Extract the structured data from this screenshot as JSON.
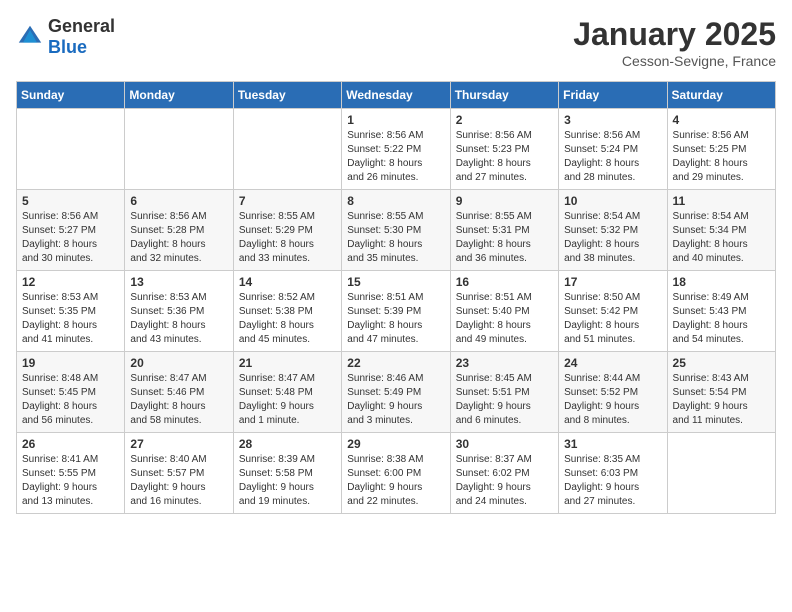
{
  "header": {
    "logo_general": "General",
    "logo_blue": "Blue",
    "month": "January 2025",
    "location": "Cesson-Sevigne, France"
  },
  "weekdays": [
    "Sunday",
    "Monday",
    "Tuesday",
    "Wednesday",
    "Thursday",
    "Friday",
    "Saturday"
  ],
  "weeks": [
    [
      {
        "day": "",
        "info": ""
      },
      {
        "day": "",
        "info": ""
      },
      {
        "day": "",
        "info": ""
      },
      {
        "day": "1",
        "info": "Sunrise: 8:56 AM\nSunset: 5:22 PM\nDaylight: 8 hours\nand 26 minutes."
      },
      {
        "day": "2",
        "info": "Sunrise: 8:56 AM\nSunset: 5:23 PM\nDaylight: 8 hours\nand 27 minutes."
      },
      {
        "day": "3",
        "info": "Sunrise: 8:56 AM\nSunset: 5:24 PM\nDaylight: 8 hours\nand 28 minutes."
      },
      {
        "day": "4",
        "info": "Sunrise: 8:56 AM\nSunset: 5:25 PM\nDaylight: 8 hours\nand 29 minutes."
      }
    ],
    [
      {
        "day": "5",
        "info": "Sunrise: 8:56 AM\nSunset: 5:27 PM\nDaylight: 8 hours\nand 30 minutes."
      },
      {
        "day": "6",
        "info": "Sunrise: 8:56 AM\nSunset: 5:28 PM\nDaylight: 8 hours\nand 32 minutes."
      },
      {
        "day": "7",
        "info": "Sunrise: 8:55 AM\nSunset: 5:29 PM\nDaylight: 8 hours\nand 33 minutes."
      },
      {
        "day": "8",
        "info": "Sunrise: 8:55 AM\nSunset: 5:30 PM\nDaylight: 8 hours\nand 35 minutes."
      },
      {
        "day": "9",
        "info": "Sunrise: 8:55 AM\nSunset: 5:31 PM\nDaylight: 8 hours\nand 36 minutes."
      },
      {
        "day": "10",
        "info": "Sunrise: 8:54 AM\nSunset: 5:32 PM\nDaylight: 8 hours\nand 38 minutes."
      },
      {
        "day": "11",
        "info": "Sunrise: 8:54 AM\nSunset: 5:34 PM\nDaylight: 8 hours\nand 40 minutes."
      }
    ],
    [
      {
        "day": "12",
        "info": "Sunrise: 8:53 AM\nSunset: 5:35 PM\nDaylight: 8 hours\nand 41 minutes."
      },
      {
        "day": "13",
        "info": "Sunrise: 8:53 AM\nSunset: 5:36 PM\nDaylight: 8 hours\nand 43 minutes."
      },
      {
        "day": "14",
        "info": "Sunrise: 8:52 AM\nSunset: 5:38 PM\nDaylight: 8 hours\nand 45 minutes."
      },
      {
        "day": "15",
        "info": "Sunrise: 8:51 AM\nSunset: 5:39 PM\nDaylight: 8 hours\nand 47 minutes."
      },
      {
        "day": "16",
        "info": "Sunrise: 8:51 AM\nSunset: 5:40 PM\nDaylight: 8 hours\nand 49 minutes."
      },
      {
        "day": "17",
        "info": "Sunrise: 8:50 AM\nSunset: 5:42 PM\nDaylight: 8 hours\nand 51 minutes."
      },
      {
        "day": "18",
        "info": "Sunrise: 8:49 AM\nSunset: 5:43 PM\nDaylight: 8 hours\nand 54 minutes."
      }
    ],
    [
      {
        "day": "19",
        "info": "Sunrise: 8:48 AM\nSunset: 5:45 PM\nDaylight: 8 hours\nand 56 minutes."
      },
      {
        "day": "20",
        "info": "Sunrise: 8:47 AM\nSunset: 5:46 PM\nDaylight: 8 hours\nand 58 minutes."
      },
      {
        "day": "21",
        "info": "Sunrise: 8:47 AM\nSunset: 5:48 PM\nDaylight: 9 hours\nand 1 minute."
      },
      {
        "day": "22",
        "info": "Sunrise: 8:46 AM\nSunset: 5:49 PM\nDaylight: 9 hours\nand 3 minutes."
      },
      {
        "day": "23",
        "info": "Sunrise: 8:45 AM\nSunset: 5:51 PM\nDaylight: 9 hours\nand 6 minutes."
      },
      {
        "day": "24",
        "info": "Sunrise: 8:44 AM\nSunset: 5:52 PM\nDaylight: 9 hours\nand 8 minutes."
      },
      {
        "day": "25",
        "info": "Sunrise: 8:43 AM\nSunset: 5:54 PM\nDaylight: 9 hours\nand 11 minutes."
      }
    ],
    [
      {
        "day": "26",
        "info": "Sunrise: 8:41 AM\nSunset: 5:55 PM\nDaylight: 9 hours\nand 13 minutes."
      },
      {
        "day": "27",
        "info": "Sunrise: 8:40 AM\nSunset: 5:57 PM\nDaylight: 9 hours\nand 16 minutes."
      },
      {
        "day": "28",
        "info": "Sunrise: 8:39 AM\nSunset: 5:58 PM\nDaylight: 9 hours\nand 19 minutes."
      },
      {
        "day": "29",
        "info": "Sunrise: 8:38 AM\nSunset: 6:00 PM\nDaylight: 9 hours\nand 22 minutes."
      },
      {
        "day": "30",
        "info": "Sunrise: 8:37 AM\nSunset: 6:02 PM\nDaylight: 9 hours\nand 24 minutes."
      },
      {
        "day": "31",
        "info": "Sunrise: 8:35 AM\nSunset: 6:03 PM\nDaylight: 9 hours\nand 27 minutes."
      },
      {
        "day": "",
        "info": ""
      }
    ]
  ]
}
